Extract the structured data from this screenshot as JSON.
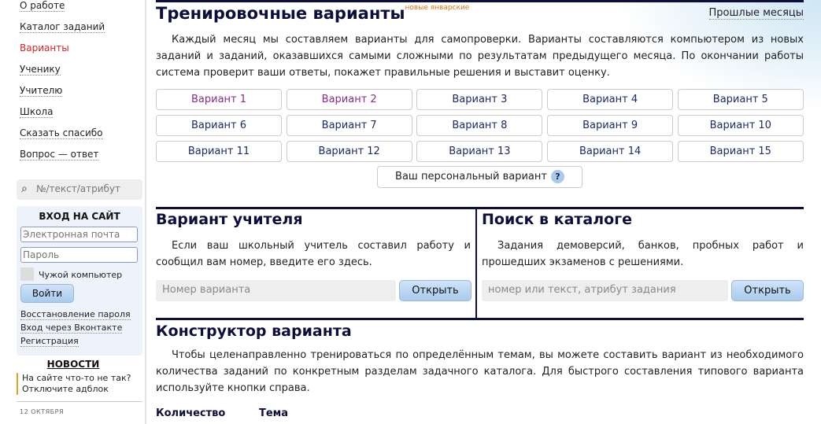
{
  "sidebar": {
    "nav": [
      {
        "label": "О работе"
      },
      {
        "label": "Каталог заданий"
      },
      {
        "label": "Варианты",
        "active": true
      },
      {
        "label": "Ученику"
      },
      {
        "label": "Учителю"
      },
      {
        "label": "Школа"
      },
      {
        "label": "Сказать спасибо"
      },
      {
        "label": "Вопрос — ответ"
      }
    ],
    "search_placeholder": "№/текст/атрибут",
    "login": {
      "title": "ВХОД НА САЙТ",
      "email_placeholder": "Электронная почта",
      "password_placeholder": "Пароль",
      "foreign_computer": "Чужой компьютер",
      "submit": "Войти",
      "restore": "Восстановление пароля",
      "vk": "Вход через Вконтакте",
      "register": "Регистрация"
    },
    "news": {
      "title": "НОВОСТИ",
      "note": "На сайте что-то не так? Отключите адблок",
      "date": "12 ОКТЯБРЯ"
    }
  },
  "training": {
    "title": "Тренировочные варианты",
    "badge": "новые январские",
    "past_link": "Прошлые месяцы",
    "description": "Каждый месяц мы составляем варианты для самопроверки. Варианты составляются компьютером из новых заданий и заданий, оказавшихся самыми сложными по результатам предыдущего месяца. По окончании работы система проверит ваши ответы, покажет правильные решения и выставит оценку.",
    "variants": [
      "Вариант 1",
      "Вариант 2",
      "Вариант 3",
      "Вариант 4",
      "Вариант 5",
      "Вариант 6",
      "Вариант 7",
      "Вариант 8",
      "Вариант 9",
      "Вариант 10",
      "Вариант 11",
      "Вариант 12",
      "Вариант 13",
      "Вариант 14",
      "Вариант 15"
    ],
    "personal": "Ваш персональный вариант",
    "help": "?"
  },
  "teacher": {
    "title": "Вариант учителя",
    "text": "Если ваш школьный учитель составил работу и сообщил вам номер, введите его здесь.",
    "placeholder": "Номер варианта",
    "button": "Открыть"
  },
  "catalog": {
    "title": "Поиск в каталоге",
    "text": "Задания демоверсий, банков, пробных работ и прошедших экзаменов с решениями.",
    "placeholder": "номер или текст, атрибут задания",
    "button": "Открыть"
  },
  "constructor": {
    "title": "Конструктор варианта",
    "text": "Чтобы целенаправленно тренироваться по определённым темам, вы можете составить вариант из необходимого количества заданий по конкретным разделам задачного каталога. Для быстрого составления типового варианта используйте кнопки справа.",
    "col_count": "Количество",
    "col_topic": "Тема"
  }
}
